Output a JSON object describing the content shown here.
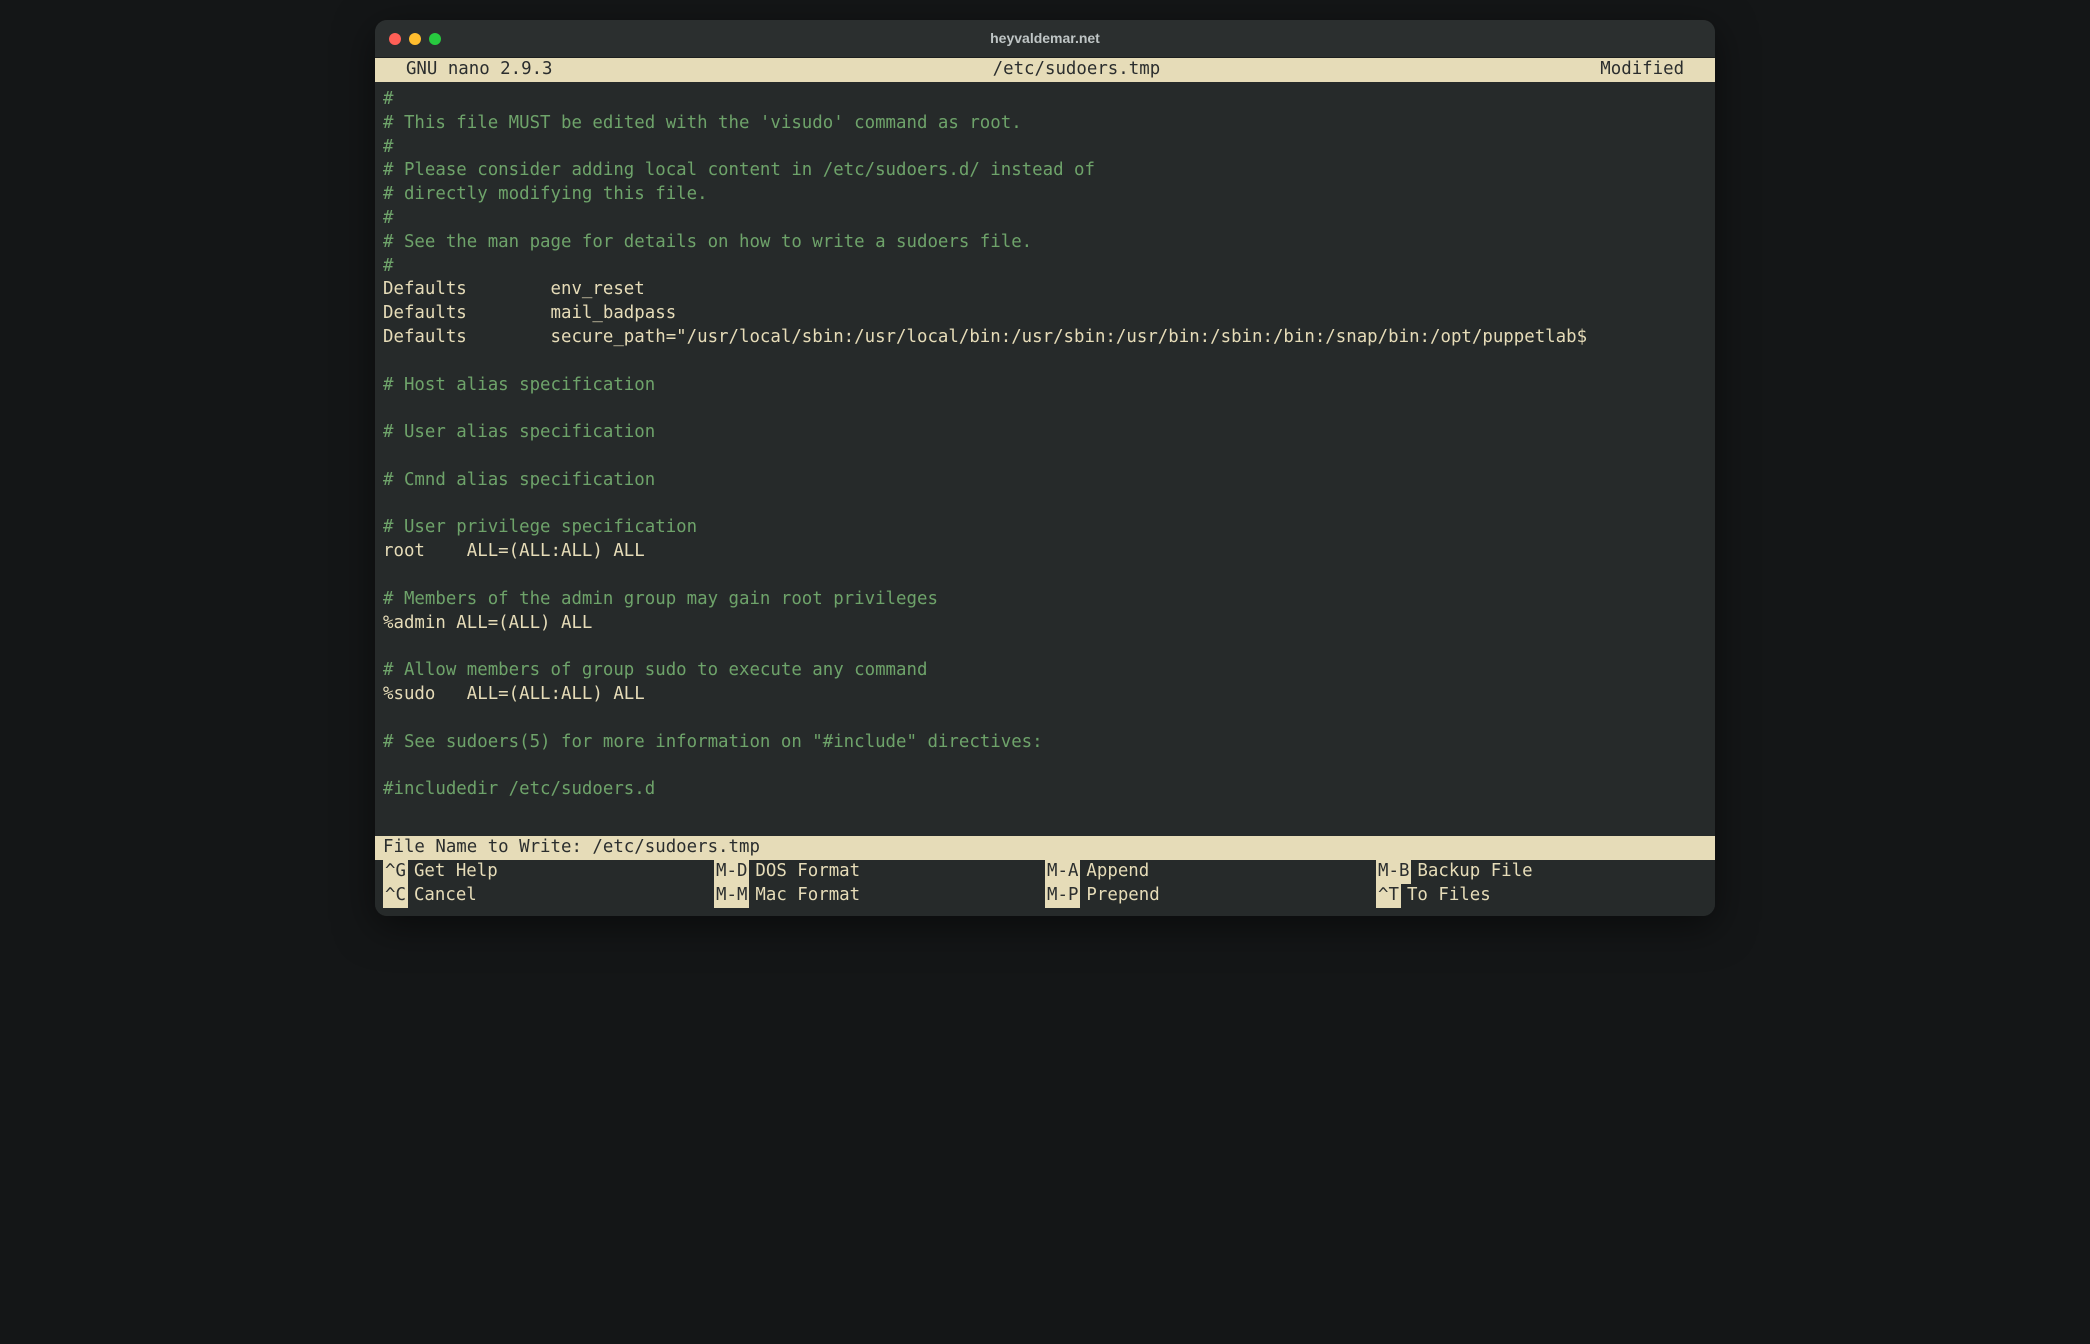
{
  "window": {
    "title": "heyvaldemar.net"
  },
  "header": {
    "app": "  GNU nano 2.9.3",
    "file": "/etc/sudoers.tmp",
    "status": "Modified  "
  },
  "file_lines": [
    {
      "cls": "c",
      "text": "#"
    },
    {
      "cls": "c",
      "text": "# This file MUST be edited with the 'visudo' command as root."
    },
    {
      "cls": "c",
      "text": "#"
    },
    {
      "cls": "c",
      "text": "# Please consider adding local content in /etc/sudoers.d/ instead of"
    },
    {
      "cls": "c",
      "text": "# directly modifying this file."
    },
    {
      "cls": "c",
      "text": "#"
    },
    {
      "cls": "c",
      "text": "# See the man page for details on how to write a sudoers file."
    },
    {
      "cls": "c",
      "text": "#"
    },
    {
      "cls": "t",
      "text": "Defaults        env_reset"
    },
    {
      "cls": "t",
      "text": "Defaults        mail_badpass"
    },
    {
      "cls": "t",
      "text": "Defaults        secure_path=\"/usr/local/sbin:/usr/local/bin:/usr/sbin:/usr/bin:/sbin:/bin:/snap/bin:/opt/puppetlab$"
    },
    {
      "cls": "t",
      "text": ""
    },
    {
      "cls": "c",
      "text": "# Host alias specification"
    },
    {
      "cls": "t",
      "text": ""
    },
    {
      "cls": "c",
      "text": "# User alias specification"
    },
    {
      "cls": "t",
      "text": ""
    },
    {
      "cls": "c",
      "text": "# Cmnd alias specification"
    },
    {
      "cls": "t",
      "text": ""
    },
    {
      "cls": "c",
      "text": "# User privilege specification"
    },
    {
      "cls": "t",
      "text": "root    ALL=(ALL:ALL) ALL"
    },
    {
      "cls": "t",
      "text": ""
    },
    {
      "cls": "c",
      "text": "# Members of the admin group may gain root privileges"
    },
    {
      "cls": "t",
      "text": "%admin ALL=(ALL) ALL"
    },
    {
      "cls": "t",
      "text": ""
    },
    {
      "cls": "c",
      "text": "# Allow members of group sudo to execute any command"
    },
    {
      "cls": "t",
      "text": "%sudo   ALL=(ALL:ALL) ALL"
    },
    {
      "cls": "t",
      "text": ""
    },
    {
      "cls": "c",
      "text": "# See sudoers(5) for more information on \"#include\" directives:"
    },
    {
      "cls": "t",
      "text": ""
    },
    {
      "cls": "c",
      "text": "#includedir /etc/sudoers.d"
    }
  ],
  "prompt": "File Name to Write: /etc/sudoers.tmp",
  "shortcuts": [
    [
      {
        "key": "^G",
        "label": "Get Help"
      },
      {
        "key": "M-D",
        "label": "DOS Format"
      },
      {
        "key": "M-A",
        "label": "Append"
      },
      {
        "key": "M-B",
        "label": "Backup File"
      }
    ],
    [
      {
        "key": "^C",
        "label": "Cancel"
      },
      {
        "key": "M-M",
        "label": "Mac Format"
      },
      {
        "key": "M-P",
        "label": "Prepend"
      },
      {
        "key": "^T",
        "label": "To Files"
      }
    ]
  ]
}
